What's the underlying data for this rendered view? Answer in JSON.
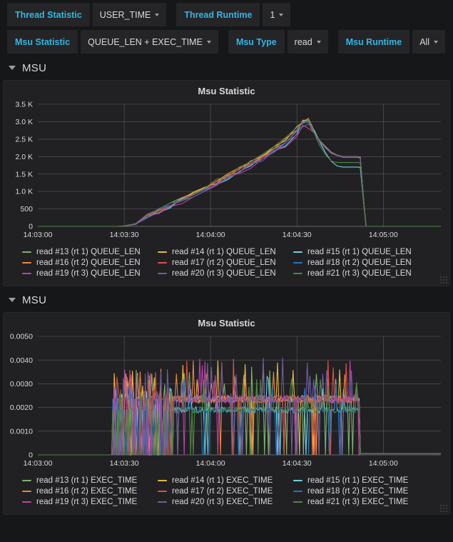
{
  "submenu": {
    "rows": [
      {
        "groups": [
          {
            "label": "Thread Statistic",
            "value": "USER_TIME",
            "has_caret": true
          },
          {
            "label": "Thread Runtime",
            "value": "1",
            "has_caret": true
          }
        ]
      },
      {
        "groups": [
          {
            "label": "Msu Statistic",
            "value": "QUEUE_LEN + EXEC_TIME",
            "has_caret": true
          },
          {
            "label": "Msu Type",
            "value": "read",
            "has_caret": true
          },
          {
            "label": "Msu Runtime",
            "value": "All",
            "has_caret": true
          }
        ]
      }
    ]
  },
  "rows": [
    {
      "title": "MSU",
      "chevron_icon": "chevron-down-icon"
    },
    {
      "title": "MSU",
      "chevron_icon": "chevron-down-icon"
    }
  ],
  "colors": {
    "green": "#7eb26d",
    "yellow": "#eab839",
    "cyan": "#6ed0e0",
    "orange": "#ef843c",
    "red": "#e24d42",
    "blue": "#1f78c1",
    "magenta": "#ba43a9",
    "purple": "#705da0",
    "darkgreen": "#508642",
    "accent_link": "#33b5e5",
    "panel_bg": "#212124",
    "page_bg": "#161719"
  },
  "chart_data": [
    {
      "type": "line",
      "title": "Msu Statistic",
      "xlabel": "",
      "ylabel": "",
      "grid": true,
      "legend_position": "bottom",
      "ylim": [
        0,
        3500
      ],
      "yticks": [
        0,
        500,
        1000,
        1500,
        2000,
        2500,
        3000,
        3500
      ],
      "ytick_labels": [
        "0",
        "500",
        "1.0 K",
        "1.5 K",
        "2.0 K",
        "2.5 K",
        "3.0 K",
        "3.5 K"
      ],
      "xlim": [
        0,
        140
      ],
      "xticks": [
        0,
        30,
        60,
        90,
        120
      ],
      "xtick_labels": [
        "14:03:00",
        "14:03:30",
        "14:04:00",
        "14:04:30",
        "14:05:00"
      ],
      "x": [
        0,
        10,
        20,
        28,
        30,
        34,
        38,
        42,
        46,
        50,
        54,
        58,
        62,
        66,
        70,
        74,
        78,
        82,
        86,
        90,
        92,
        94,
        95,
        96,
        97,
        98,
        100,
        102,
        104,
        106,
        108,
        110,
        111,
        112,
        113,
        114,
        140
      ],
      "series": [
        {
          "name": "read #13 (rt 1) QUEUE_LEN",
          "color": "#7eb26d",
          "values": [
            0,
            0,
            0,
            0,
            10,
            140,
            290,
            440,
            600,
            760,
            900,
            1070,
            1240,
            1420,
            1600,
            1790,
            1990,
            2180,
            2400,
            2720,
            2960,
            3020,
            2860,
            2700,
            2540,
            2420,
            2240,
            2090,
            2030,
            1980,
            1980,
            1980,
            1980,
            1960,
            900,
            0,
            0
          ]
        },
        {
          "name": "read #14 (rt 1) QUEUE_LEN",
          "color": "#eab839",
          "values": [
            0,
            0,
            0,
            0,
            12,
            150,
            310,
            460,
            630,
            790,
            940,
            1110,
            1290,
            1470,
            1660,
            1850,
            2050,
            2260,
            2500,
            2800,
            3000,
            3060,
            2900,
            2740,
            2560,
            2450,
            2280,
            2120,
            2040,
            2000,
            2000,
            2000,
            2000,
            1990,
            950,
            0,
            0
          ]
        },
        {
          "name": "read #15 (rt 1) QUEUE_LEN",
          "color": "#6ed0e0",
          "values": [
            0,
            0,
            0,
            0,
            9,
            130,
            280,
            430,
            580,
            740,
            880,
            1050,
            1220,
            1390,
            1570,
            1760,
            1960,
            2150,
            2380,
            2700,
            2980,
            3090,
            2920,
            2760,
            2580,
            2400,
            2100,
            1860,
            1730,
            1700,
            1700,
            1700,
            1700,
            1690,
            820,
            0,
            0
          ]
        },
        {
          "name": "read #16 (rt 2) QUEUE_LEN",
          "color": "#ef843c",
          "values": [
            0,
            0,
            0,
            0,
            11,
            145,
            300,
            455,
            620,
            780,
            930,
            1100,
            1280,
            1460,
            1650,
            1840,
            2040,
            2240,
            2470,
            2790,
            3010,
            3040,
            2880,
            2720,
            2550,
            2440,
            2260,
            2110,
            2035,
            1995,
            1995,
            1995,
            1995,
            1985,
            930,
            0,
            0
          ]
        },
        {
          "name": "read #17 (rt 2) QUEUE_LEN",
          "color": "#e24d42",
          "values": [
            0,
            0,
            0,
            0,
            10,
            138,
            288,
            438,
            595,
            755,
            895,
            1065,
            1235,
            1410,
            1590,
            1780,
            1980,
            2170,
            2390,
            2710,
            2950,
            3000,
            2850,
            2690,
            2530,
            2420,
            2250,
            2100,
            2030,
            1990,
            1990,
            1990,
            1990,
            1980,
            900,
            0,
            0
          ]
        },
        {
          "name": "read #18 (rt 2) QUEUE_LEN",
          "color": "#1f78c1",
          "values": [
            0,
            0,
            0,
            0,
            10,
            142,
            292,
            445,
            605,
            765,
            905,
            1075,
            1245,
            1425,
            1605,
            1795,
            1995,
            2185,
            2405,
            2725,
            2965,
            3010,
            2855,
            2700,
            2540,
            2430,
            2255,
            2105,
            2032,
            1992,
            1992,
            1992,
            1992,
            1982,
            910,
            0,
            0
          ]
        },
        {
          "name": "read #19 (rt 3) QUEUE_LEN",
          "color": "#ba43a9",
          "values": [
            0,
            0,
            0,
            0,
            8,
            125,
            270,
            415,
            565,
            720,
            860,
            1025,
            1195,
            1365,
            1545,
            1730,
            1925,
            2110,
            2330,
            2640,
            2830,
            2880,
            2790,
            2680,
            2520,
            2415,
            2245,
            2098,
            2028,
            1988,
            1988,
            1988,
            1988,
            1978,
            890,
            0,
            0
          ]
        },
        {
          "name": "read #20 (rt 3) QUEUE_LEN",
          "color": "#705da0",
          "values": [
            0,
            0,
            0,
            0,
            9,
            128,
            275,
            420,
            575,
            730,
            870,
            1035,
            1205,
            1380,
            1558,
            1745,
            1940,
            2125,
            2345,
            2660,
            2850,
            2900,
            2800,
            2690,
            2525,
            2418,
            2248,
            2100,
            2030,
            1990,
            1990,
            1990,
            1990,
            1980,
            895,
            0,
            0
          ]
        },
        {
          "name": "read #21 (rt 3) QUEUE_LEN",
          "color": "#508642",
          "values": [
            0,
            0,
            0,
            0,
            11,
            148,
            305,
            465,
            635,
            795,
            945,
            1120,
            1300,
            1480,
            1670,
            1862,
            2065,
            2270,
            2520,
            2830,
            3020,
            3070,
            2880,
            2690,
            2480,
            2300,
            2050,
            1870,
            1830,
            1830,
            1830,
            1830,
            1830,
            1820,
            850,
            0,
            0
          ]
        }
      ]
    },
    {
      "type": "line",
      "title": "Msu Statistic",
      "xlabel": "",
      "ylabel": "",
      "grid": true,
      "legend_position": "bottom",
      "ylim": [
        0,
        0.005
      ],
      "yticks": [
        0,
        0.001,
        0.002,
        0.003,
        0.004,
        0.005
      ],
      "ytick_labels": [
        "0",
        "0.0010",
        "0.0020",
        "0.0030",
        "0.0040",
        "0.0050"
      ],
      "xlim": [
        0,
        140
      ],
      "xticks": [
        0,
        30,
        60,
        90,
        120
      ],
      "xtick_labels": [
        "14:03:00",
        "14:03:30",
        "14:04:00",
        "14:04:30",
        "14:05:00"
      ],
      "series": [
        {
          "name": "read #13 (rt 1) EXEC_TIME",
          "color": "#7eb26d"
        },
        {
          "name": "read #14 (rt 1) EXEC_TIME",
          "color": "#eab839"
        },
        {
          "name": "read #15 (rt 1) EXEC_TIME",
          "color": "#6ed0e0"
        },
        {
          "name": "read #16 (rt 2) EXEC_TIME",
          "color": "#ef843c"
        },
        {
          "name": "read #17 (rt 2) EXEC_TIME",
          "color": "#e24d42"
        },
        {
          "name": "read #18 (rt 2) EXEC_TIME",
          "color": "#1f78c1"
        },
        {
          "name": "read #19 (rt 3) EXEC_TIME",
          "color": "#ba43a9"
        },
        {
          "name": "read #20 (rt 3) EXEC_TIME",
          "color": "#705da0"
        },
        {
          "name": "read #21 (rt 3) EXEC_TIME",
          "color": "#508642"
        }
      ],
      "noise_profile": {
        "ramp_start": 26,
        "chaotic_end": 47,
        "steady_level": 0.00235,
        "low_level": 0.0019,
        "spike_max": 0.0041,
        "drop_time": 112,
        "tail_level": 5e-05
      }
    }
  ]
}
